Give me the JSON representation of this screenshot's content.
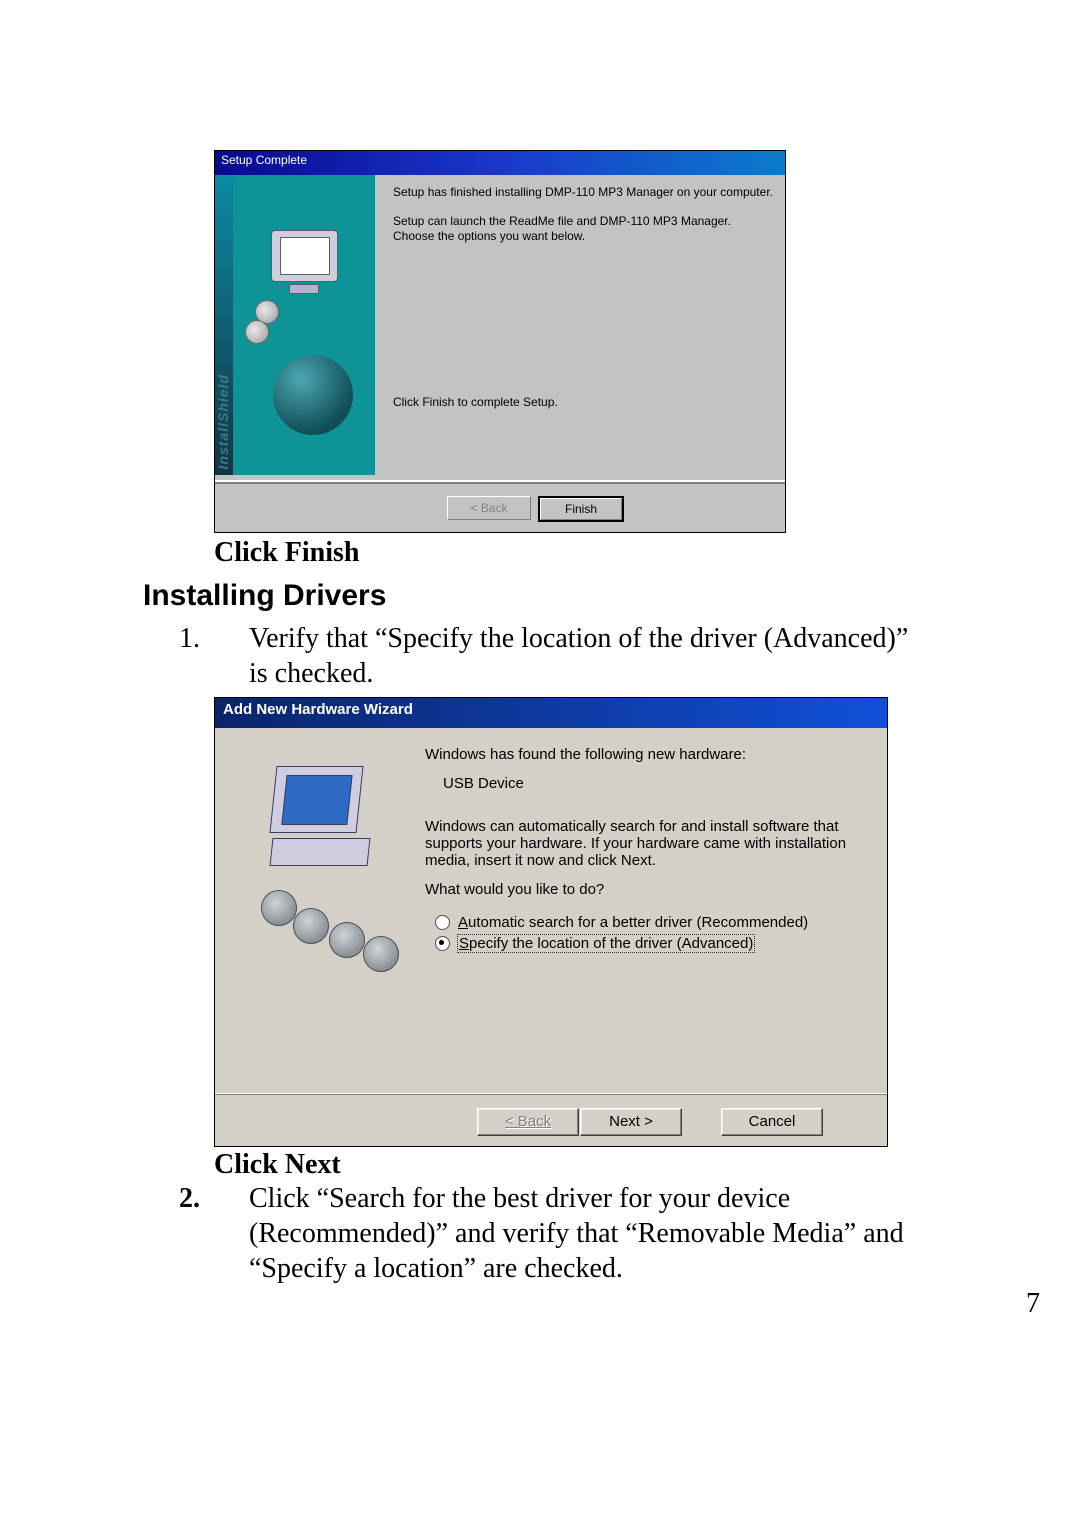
{
  "page_number": "7",
  "setup": {
    "title": "Setup Complete",
    "para1": "Setup has finished installing DMP-110 MP3 Manager on your computer.",
    "para2": "Setup can launch the ReadMe file and DMP-110 MP3 Manager.  Choose the options you want below.",
    "click_finish_line": "Click Finish to complete Setup.",
    "back_btn": "< Back",
    "finish_btn": "Finish"
  },
  "after_setup_callout": "Click Finish",
  "heading_drivers": "Installing Drivers",
  "step1": {
    "num": "1.",
    "text": "Verify that “Specify the location of the driver (Advanced)” is checked."
  },
  "wizard": {
    "title": "Add New Hardware Wizard",
    "found_line": "Windows has found the following new hardware:",
    "device": "USB Device",
    "auto_para": "Windows can automatically search for and install software that supports your hardware. If your hardware came with installation media, insert it now and click Next.",
    "what_line": "What would you like to do?",
    "opt_auto_prefix": "A",
    "opt_auto_rest": "utomatic search for a better driver (Recommended)",
    "opt_spec_prefix": "S",
    "opt_spec_rest": "pecify the location of the driver (Advanced)",
    "back_btn": "< Back",
    "next_btn": "Next >",
    "cancel_btn": "Cancel"
  },
  "after_wizard_callout": "Click Next",
  "step2": {
    "num": "2.",
    "text": "Click “Search for the best driver for your device (Recommended)” and verify that “Removable Media” and “Specify a location” are checked."
  }
}
